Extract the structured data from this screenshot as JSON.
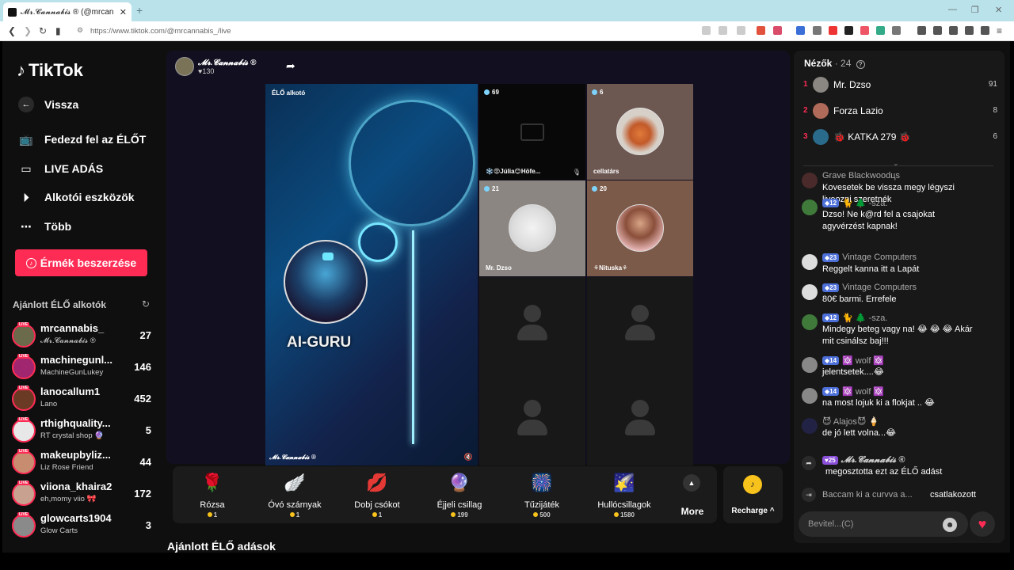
{
  "browser": {
    "tab_title": "𝓜𝓻.𝓒𝓪𝓷𝓷𝓪𝓫𝓲𝓼 ® (@mrcan",
    "tab_close": "✕",
    "new_tab": "+",
    "url": "https://www.tiktok.com/@mrcannabis_/live",
    "win_min": "—",
    "win_max": "❐",
    "win_close": "✕"
  },
  "sidebar": {
    "logo": "TikTok",
    "back": "Vissza",
    "nav": [
      {
        "label": "Fedezd fel az ÉLŐT",
        "icon": "tv-icon"
      },
      {
        "label": "LIVE ADÁS",
        "icon": "video-camera-icon"
      },
      {
        "label": "Alkotói eszközök",
        "icon": "creator-tools-icon"
      },
      {
        "label": "Több",
        "icon": "more-dots-icon"
      }
    ],
    "earn_button": "Érmék beszerzése",
    "suggested_heading": "Ajánlott ÉLŐ alkotók",
    "suggested": [
      {
        "name": "mrcannabis_",
        "sub": "𝓜𝓻.𝓒𝓪𝓷𝓷𝓪𝓫𝓲𝓼 ®",
        "count": "27",
        "color": "#6b6a4a"
      },
      {
        "name": "machinegunl...",
        "sub": "MachineGunLukey",
        "count": "146",
        "color": "#a0266f"
      },
      {
        "name": "lanocallum1",
        "sub": "Lano",
        "count": "452",
        "color": "#6a3a24"
      },
      {
        "name": "rthighquality...",
        "sub": "RT crystal shop 🔮",
        "count": "5",
        "color": "#e8e8e8"
      },
      {
        "name": "makeupbyliz...",
        "sub": "Liz Rose Friend",
        "count": "44",
        "color": "#c88d70"
      },
      {
        "name": "viiona_khaira2",
        "sub": "eh,momy viio 🎀",
        "count": "172",
        "color": "#c9a190"
      },
      {
        "name": "glowcarts1904",
        "sub": "Glow Carts",
        "count": "3",
        "color": "#8a8a8a"
      }
    ],
    "live_tag": "LIVE"
  },
  "stream": {
    "host_name": "𝓜𝓻.𝓒𝓪𝓷𝓷𝓪𝓫𝓲𝓼 ®",
    "host_likes": "♥130",
    "main_label": "ÉLŐ alkotó",
    "main_title": "AI-GURU",
    "main_footer": "𝓜𝓻.𝓒𝓪𝓷𝓷𝓪𝓫𝓲𝓼 ®",
    "guests": [
      {
        "viewers": "69",
        "name": "❄️😡Júlia😊Höfe...",
        "bg": "#080808"
      },
      {
        "viewers": "6",
        "name": "cellatárs",
        "bg": "#6c5751"
      },
      {
        "viewers": "21",
        "name": "Mr. Dzso",
        "bg": "#8b8682"
      },
      {
        "viewers": "20",
        "name": "⚘Nituska⚘",
        "bg": "#7b5a49"
      }
    ]
  },
  "gifts": [
    {
      "name": "Rózsa",
      "price": "1",
      "icon": "🌹"
    },
    {
      "name": "Óvó szárnyak",
      "price": "1",
      "icon": "🪽"
    },
    {
      "name": "Dobj csókot",
      "price": "1",
      "icon": "💋"
    },
    {
      "name": "Éjjeli csillag",
      "price": "199",
      "icon": "🔮"
    },
    {
      "name": "Tűzijáték",
      "price": "500",
      "icon": "🎆"
    },
    {
      "name": "Hullócsillagok",
      "price": "1580",
      "icon": "🌠"
    }
  ],
  "gifts_more": "More",
  "recharge": "Recharge ^",
  "recommended_live": "Ajánlott ÉLŐ adások",
  "chat": {
    "viewers_label": "Nézők",
    "viewers_count": "· 24",
    "top_viewers": [
      {
        "rank": "1",
        "name": "Mr. Dzso",
        "score": "91",
        "color": "#8a8682"
      },
      {
        "rank": "2",
        "name": "Forza Lazio",
        "score": "8",
        "color": "#b06a5a"
      },
      {
        "rank": "3",
        "name": "🐞 KATKA 279 🐞",
        "score": "6",
        "color": "#2a6b8c"
      }
    ],
    "messages": [
      {
        "badge": "",
        "user": "Grave Blackwoodцs",
        "text": "Kovesetek be vissza megy légyszi liveozni szeretnék",
        "color": "#4a2a2a"
      },
      {
        "badge": "12",
        "user": "🐈 🌲 -sza.",
        "text": "Dzso! Ne k@rd fel a csajokat agyvérzést kapnak!",
        "color": "#3f7a3a"
      },
      {
        "badge": "23",
        "user": "Vintage Computers",
        "text": "Reggelt kanna itt a Lapát",
        "color": "#dddddd"
      },
      {
        "badge": "23",
        "user": "Vintage Computers",
        "text": "80€ barmi. Errefele",
        "color": "#dddddd"
      },
      {
        "badge": "12",
        "user": "🐈 🌲 -sza.",
        "text": "Mindegy beteg vagy na! 😂 😂 😂 Akár mit csinálsz baj!!!",
        "color": "#3f7a3a"
      },
      {
        "badge": "14",
        "user": "🔯 wolf 🔯",
        "text": "jelentsetek....😂",
        "color": "#888888"
      },
      {
        "badge": "14",
        "user": "🔯 wolf 🔯",
        "text": "na most lojuk ki a flokjat .. 😂",
        "color": "#888888"
      },
      {
        "badge": "",
        "user": "😈 Alajos😈 🍦",
        "text": "de jó lett volna...😂",
        "color": "#222244"
      }
    ],
    "share_event": {
      "badge": "25",
      "user": "𝓜𝓻.𝓒𝓪𝓷𝓷𝓪𝓫𝓲𝓼 ®",
      "text": "megosztotta ezt az ÉLŐ adást"
    },
    "join_event": {
      "user": "Baccam ki a curvva a...",
      "text": "csatlakozott"
    },
    "input_placeholder": "Bevitel...(C)"
  }
}
